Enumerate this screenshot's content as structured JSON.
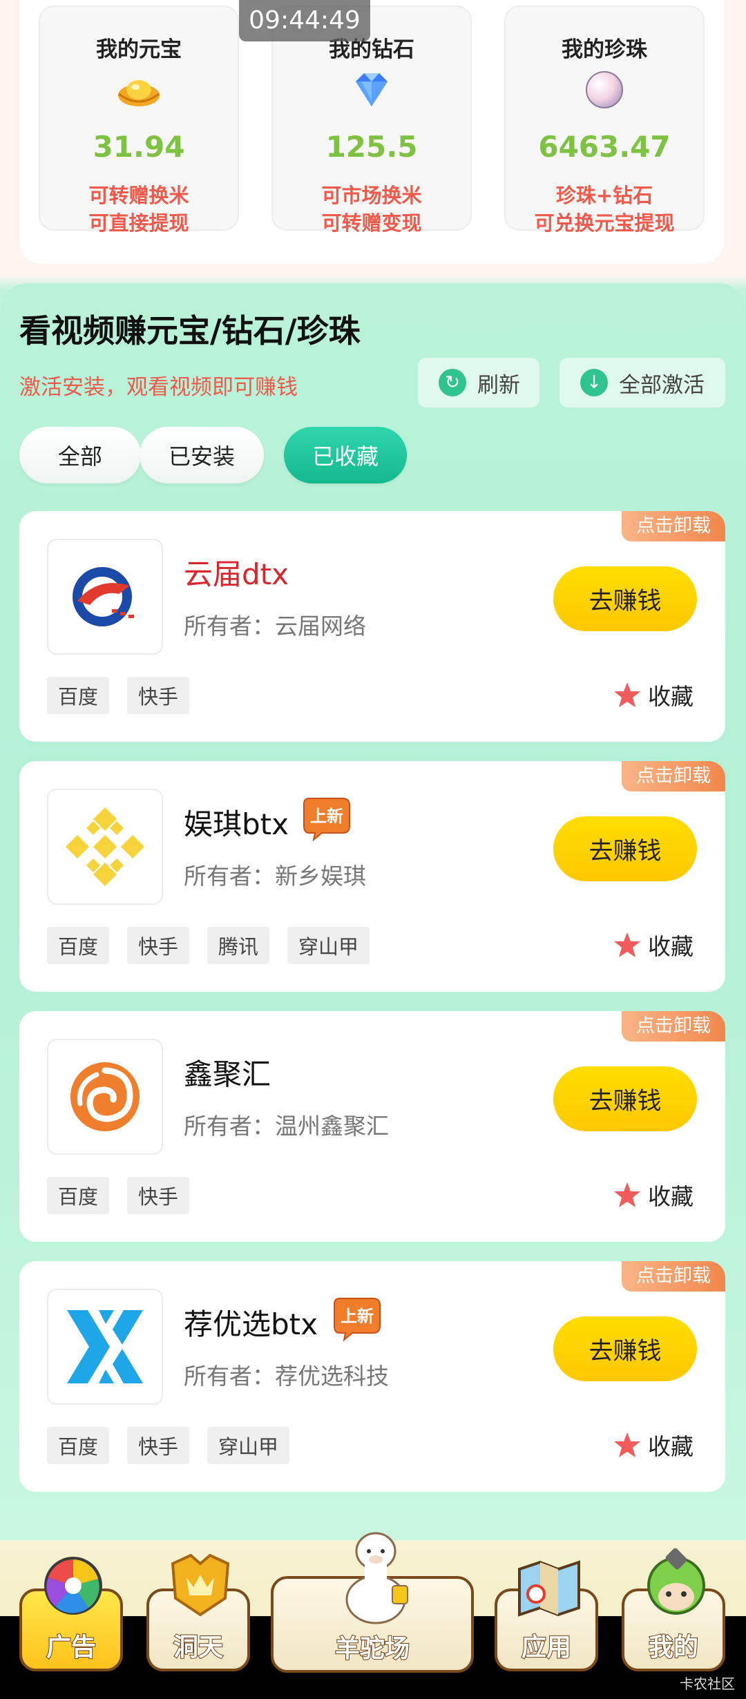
{
  "status_time": "09:44:49",
  "wallet": [
    {
      "title": "我的元宝",
      "value": "31.94",
      "line1": "可转赠换米",
      "line2": "可直接提现",
      "icon": "gold-ingot-icon"
    },
    {
      "title": "我的钻石",
      "value": "125.5",
      "line1": "可市场换米",
      "line2": "可转赠变现",
      "icon": "diamond-icon"
    },
    {
      "title": "我的珍珠",
      "value": "6463.47",
      "line1": "珍珠+钻石",
      "line2": "可兑换元宝提现",
      "icon": "pearl-icon"
    }
  ],
  "section": {
    "title": "看视频赚元宝/钻石/珍珠",
    "subtitle": "激活安装，观看视频即可赚钱",
    "refresh_label": "刷新",
    "activate_all_label": "全部激活"
  },
  "filters": [
    {
      "label": "全部",
      "active": false
    },
    {
      "label": "已安装",
      "active": false
    },
    {
      "label": "已收藏",
      "active": true
    }
  ],
  "apps": [
    {
      "name": "云届dtx",
      "owner": "所有者：云届网络",
      "is_new": false,
      "tags": [
        "百度",
        "快手"
      ],
      "uninstall": "点击卸载",
      "earn": "去赚钱",
      "fav": "收藏",
      "name_color": "#d9262c"
    },
    {
      "name": "娱琪btx",
      "owner": "所有者：新乡娱琪",
      "is_new": true,
      "new_label": "上新",
      "tags": [
        "百度",
        "快手",
        "腾讯",
        "穿山甲"
      ],
      "uninstall": "点击卸载",
      "earn": "去赚钱",
      "fav": "收藏"
    },
    {
      "name": "鑫聚汇",
      "owner": "所有者：温州鑫聚汇",
      "is_new": false,
      "tags": [
        "百度",
        "快手"
      ],
      "uninstall": "点击卸载",
      "earn": "去赚钱",
      "fav": "收藏"
    },
    {
      "name": "荐优选btx",
      "owner": "所有者：荐优选科技",
      "is_new": true,
      "new_label": "上新",
      "tags": [
        "百度",
        "快手",
        "穿山甲"
      ],
      "uninstall": "点击卸载",
      "earn": "去赚钱",
      "fav": "收藏"
    }
  ],
  "nav": [
    {
      "label": "广告",
      "active": true,
      "icon": "color-wheel-icon"
    },
    {
      "label": "洞天",
      "active": false,
      "icon": "crown-shield-icon"
    },
    {
      "label": "羊驼场",
      "active": false,
      "icon": "alpaca-icon"
    },
    {
      "label": "应用",
      "active": false,
      "icon": "map-icon"
    },
    {
      "label": "我的",
      "active": false,
      "icon": "avatar-icon"
    }
  ],
  "watermark": "卡农社区"
}
